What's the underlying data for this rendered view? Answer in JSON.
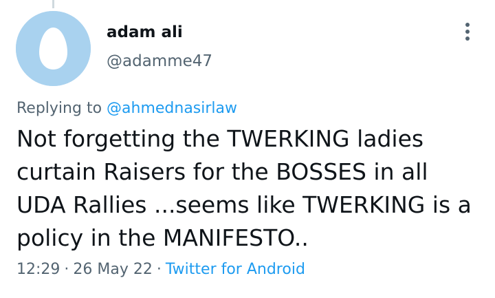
{
  "tweet": {
    "author": {
      "display_name": "adam ali",
      "handle": "@adamme47",
      "avatar_color": "#a9d2ef"
    },
    "reply_prefix": "Replying to",
    "reply_to": "@ahmednasirlaw",
    "text": "Not forgetting the TWERKING ladies curtain Raisers for the BOSSES in all UDA Rallies ...seems like TWERKING is a policy in the MANIFESTO..",
    "time": "12:29",
    "date": "26 May 22",
    "separator": "·",
    "source": "Twitter for Android"
  },
  "icons": {
    "more": "more-vertical-icon",
    "avatar": "default-egg-avatar-icon"
  },
  "colors": {
    "accent": "#1d9bf0",
    "secondary_text": "#536471",
    "primary_text": "#0f1419"
  }
}
